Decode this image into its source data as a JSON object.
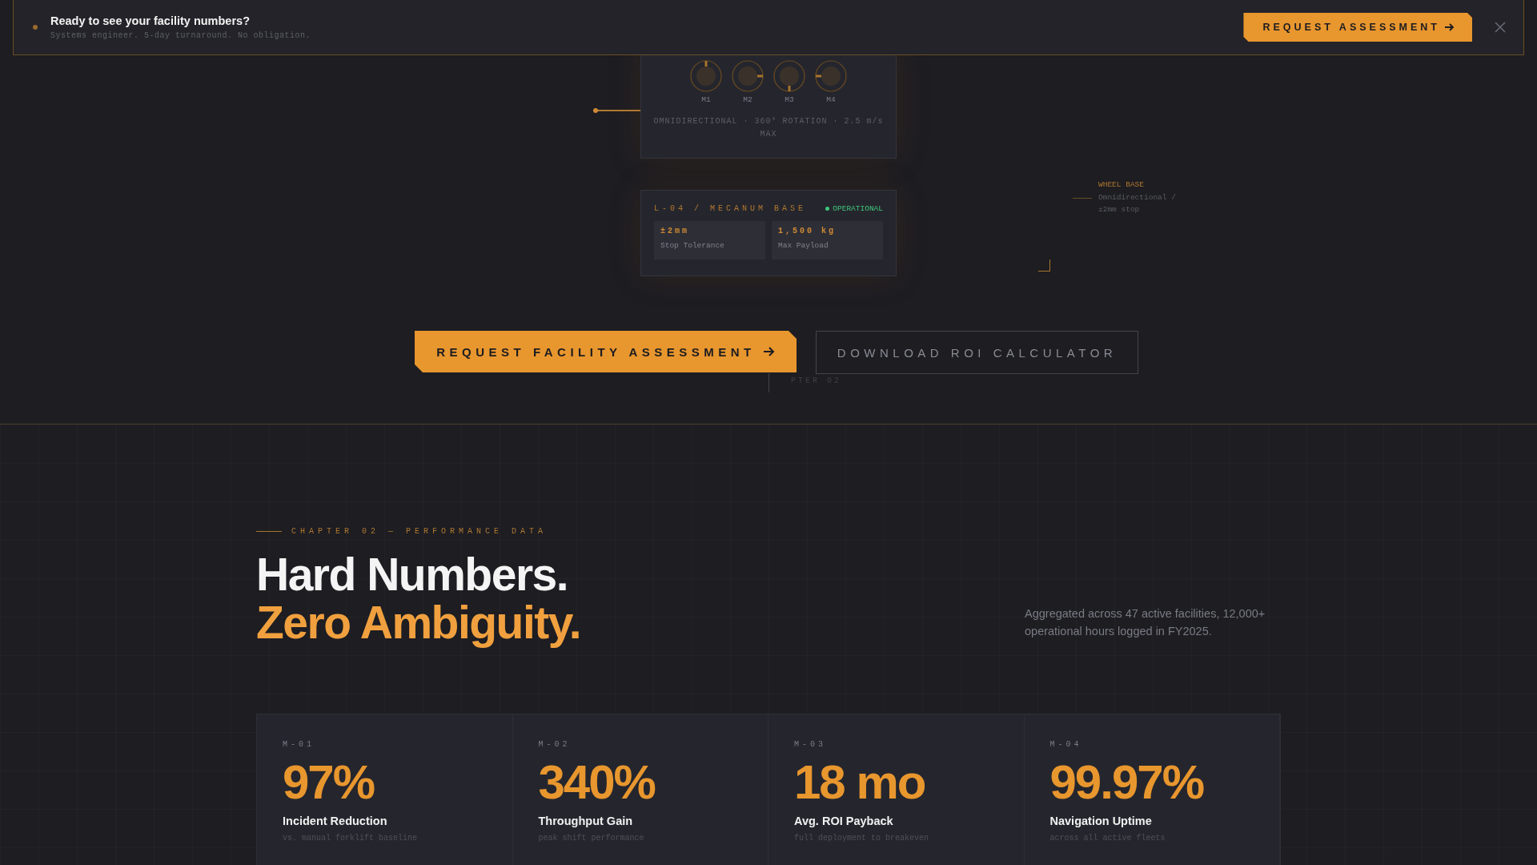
{
  "banner": {
    "title": "Ready to see your facility numbers?",
    "subtitle": "Systems engineer. 5-day turnaround. No obligation.",
    "button": "REQUEST ASSESSMENT"
  },
  "diagram": {
    "motors": [
      "M1",
      "M2",
      "M3",
      "M4"
    ],
    "caption": "OMNIDIRECTIONAL · 360° ROTATION · 2.5 m/s MAX",
    "module": {
      "title": "L-04 / MECANUM BASE",
      "status": "OPERATIONAL",
      "specs": [
        {
          "value": "±2mm",
          "label": "Stop Tolerance"
        },
        {
          "value": "1,500 kg",
          "label": "Max Payload"
        }
      ]
    },
    "annotation": {
      "title": "WHEEL BASE",
      "text": "Omnidirectional / ±2mm stop"
    }
  },
  "cta": {
    "primary": "REQUEST FACILITY ASSESSMENT",
    "secondary": "DOWNLOAD ROI CALCULATOR",
    "ghost": "PTER 02"
  },
  "section": {
    "eyebrow": "CHAPTER 02 — PERFORMANCE DATA",
    "heading_line_1": "Hard Numbers.",
    "heading_line_2": "Zero Ambiguity.",
    "summary": "Aggregated across 47 active facilities, 12,000+ operational hours logged in FY2025."
  },
  "metrics": [
    {
      "code": "M-01",
      "value": "97%",
      "title": "Incident Reduction",
      "note": "vs. manual forklift baseline"
    },
    {
      "code": "M-02",
      "value": "340%",
      "title": "Throughput Gain",
      "note": "peak shift performance"
    },
    {
      "code": "M-03",
      "value": "18 mo",
      "title": "Avg. ROI Payback",
      "note": "full deployment to breakeven"
    },
    {
      "code": "M-04",
      "value": "99.97%",
      "title": "Navigation Uptime",
      "note": "across all active fleets"
    }
  ]
}
